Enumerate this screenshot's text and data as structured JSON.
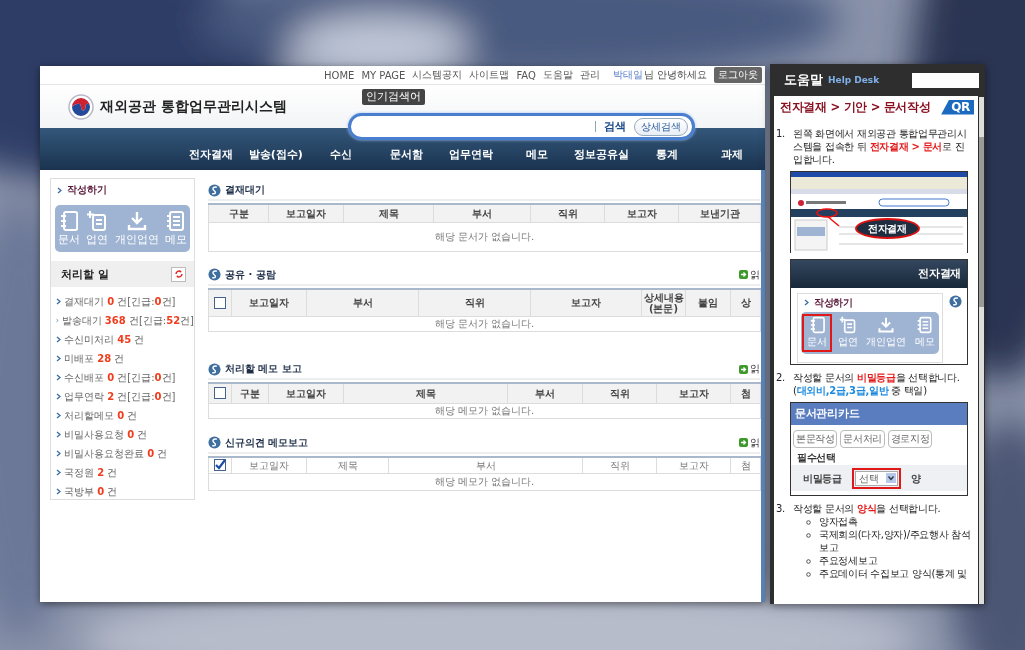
{
  "main_window": {
    "top_links": [
      "HOME",
      "MY PAGE",
      "시스템공지",
      "사이트맵",
      "FAQ",
      "도움말",
      "관리"
    ],
    "user_name": "박태일",
    "greeting": "님 안녕하세요",
    "logout_button": "로그아웃",
    "system_title": "재외공관 통합업무관리시스템",
    "search": {
      "tooltip": "인기검색어",
      "search_label": "검색",
      "advanced_button": "상세검색"
    },
    "nav": [
      "전자결재",
      "발송(접수)",
      "수신",
      "문서함",
      "업무연락",
      "메모",
      "정보공유실",
      "통계",
      "과제"
    ],
    "compose": {
      "title": "작성하기",
      "buttons": [
        "문서",
        "업연",
        "개인업연",
        "메모"
      ]
    },
    "todo": {
      "title": "처리할 일",
      "items": [
        "결재대기 **0** 건[긴급:**0**건]",
        "발송대기 **368** 건[긴급:**52**건]",
        "수신미처리 **45** 건",
        "미배포 **28** 건",
        "수신배포 **0** 건[긴급:**0**건]",
        "업무연락 **2** 건[긴급:**0**건]",
        "처리할메모 **0** 건",
        "비밀사용요청 **0** 건",
        "비밀사용요청완료 **0** 건",
        "국정원 **2** 건",
        "국방부 **0** 건"
      ]
    },
    "sections": [
      {
        "title": "결재대기",
        "header_bold": true,
        "columns": [
          "구분",
          "보고일자",
          "제목",
          "부서",
          "직위",
          "보고자",
          "보낸기관"
        ],
        "empty_message": "해당 문서가 없습니다."
      },
      {
        "title": "공유 · 공람",
        "read_link": "읽",
        "select_all": {
          "checked": false
        },
        "header_bold": true,
        "columns": [
          "보고일자",
          "부서",
          "직위",
          "보고자",
          "상세내용 (본문)",
          "붙임",
          "상"
        ],
        "empty_message": "해당 문서가 없습니다."
      },
      {
        "title": "처리할 메모 보고",
        "read_link": "읽",
        "select_all": {
          "checked": false
        },
        "header_bold": true,
        "columns": [
          "구분",
          "보고일자",
          "제목",
          "부서",
          "직위",
          "보고자",
          "첨"
        ],
        "empty_message": "해당 메모가 없습니다."
      },
      {
        "title": "신규의견 메모보고",
        "read_link": "읽",
        "select_all": {
          "checked": true
        },
        "header_bold": false,
        "columns": [
          "보고일자",
          "제목",
          "부서",
          "직위",
          "보고자",
          "첨"
        ],
        "empty_message": "해당 메모가 없습니다."
      }
    ]
  },
  "help_panel": {
    "title": "도움말",
    "subtitle": "Help Desk",
    "breadcrumb": "전자결재 > 기안 > 문서작성",
    "badge": "QR",
    "steps": [
      {
        "number": "1.",
        "parts": [
          {
            "text": "왼쪽 화면에서 재외공관 통합업무관리시스템을 접속한 뒤 "
          },
          {
            "text": "전자결재 > 문서",
            "kind": "highlight"
          },
          {
            "text": "로 진입합니다."
          }
        ],
        "figures": [
          {
            "kind": "browser",
            "callout": "전자결재"
          },
          {
            "kind": "compose",
            "header": "전자결재",
            "title": "작성하기",
            "buttons": [
              {
                "label": "문서",
                "selected": true
              },
              {
                "label": "업연",
                "selected": false
              },
              {
                "label": "개인업연",
                "selected": false
              },
              {
                "label": "메모",
                "selected": false
              }
            ]
          }
        ]
      },
      {
        "number": "2.",
        "parts": [
          {
            "text": "작성할 문서의 "
          },
          {
            "text": "비밀등급",
            "kind": "highlight"
          },
          {
            "text": "을 선택합니다. ("
          },
          {
            "text": "대외비,2급,3급,일반",
            "kind": "option"
          },
          {
            "text": " 중 택일)"
          }
        ],
        "figures": [
          {
            "kind": "card",
            "title": "문서관리카드",
            "buttons": [
              "본문작성",
              "문서처리",
              "경로지정"
            ],
            "section_label": "필수선택",
            "field_label": "비밀등급",
            "select_value": "선택",
            "next_label": "양"
          }
        ]
      },
      {
        "number": "3.",
        "parts": [
          {
            "text": "작성할 문서의 "
          },
          {
            "text": "양식",
            "kind": "highlight"
          },
          {
            "text": "을 선택합니다."
          }
        ],
        "bullets": [
          "양자접촉",
          "국제회의(다자,양자)/주요행사 참석보고",
          "주요정세보고",
          "주요데이터 수집보고 양식(통계 및"
        ]
      }
    ]
  }
}
